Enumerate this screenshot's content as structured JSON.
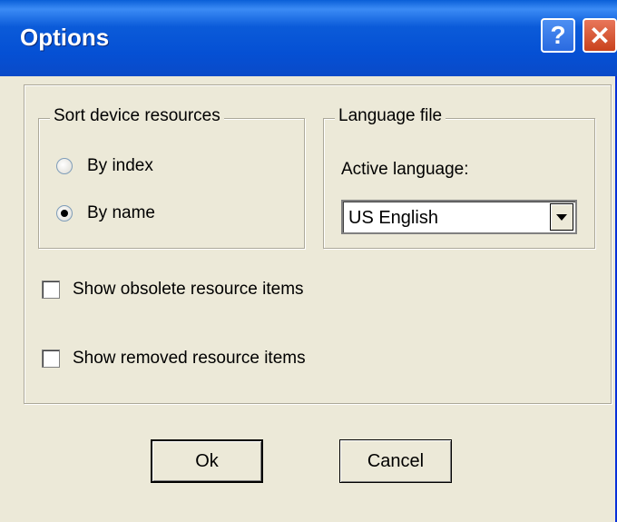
{
  "window": {
    "title": "Options",
    "help_glyph": "?",
    "close_glyph": "✕"
  },
  "sort_group": {
    "legend": "Sort device resources",
    "options": [
      {
        "label": "By index",
        "checked": false
      },
      {
        "label": "By name",
        "checked": true
      }
    ]
  },
  "language_group": {
    "legend": "Language file",
    "active_label": "Active language:",
    "selected_value": "US English"
  },
  "checkboxes": [
    {
      "label": "Show obsolete resource items",
      "checked": false
    },
    {
      "label": "Show removed resource items",
      "checked": false
    }
  ],
  "buttons": {
    "ok": "Ok",
    "cancel": "Cancel"
  }
}
